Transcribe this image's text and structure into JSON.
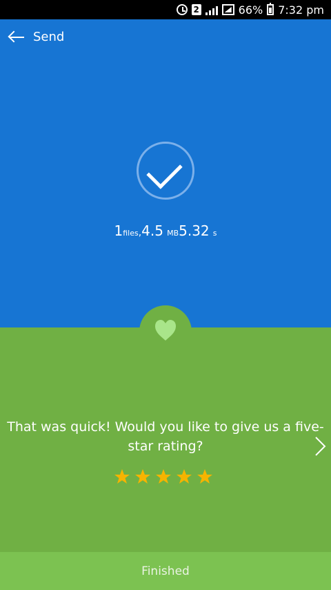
{
  "status_bar": {
    "sim_label": "2",
    "battery_percent": "66%",
    "time": "7:32 pm"
  },
  "header": {
    "title": "Send"
  },
  "transfer_summary": {
    "files_count": "1",
    "files_unit": "files",
    "size_value": "4.5",
    "size_unit": "MB",
    "duration_value": "5.32",
    "duration_unit": "s"
  },
  "rating": {
    "prompt": "That was quick! Would you like to give us a five-star rating?",
    "stars": 5,
    "star_color": "#f6b400"
  },
  "footer": {
    "finished_label": "Finished"
  },
  "colors": {
    "header_blue": "#1775d3",
    "rating_green": "#70b044",
    "footer_green": "#7cc251",
    "heart_light_green": "#a9e58a"
  }
}
